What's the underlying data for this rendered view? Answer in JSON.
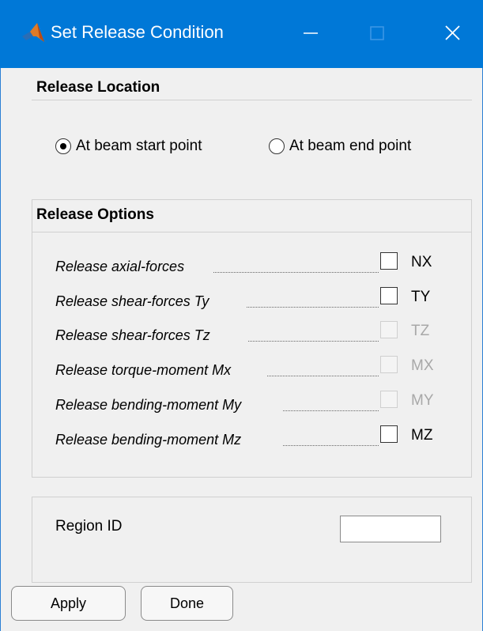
{
  "window": {
    "title": "Set Release Condition",
    "accent_color": "#0078d7",
    "icon": "matlab-logo-icon"
  },
  "release_location": {
    "heading": "Release Location",
    "options": [
      {
        "label": "At beam start point",
        "selected": true
      },
      {
        "label": "At beam end point",
        "selected": false
      }
    ]
  },
  "release_options": {
    "heading": "Release Options",
    "items": [
      {
        "label": "Release axial-forces",
        "code": "NX",
        "checked": false,
        "enabled": true
      },
      {
        "label": "Release shear-forces Ty",
        "code": "TY",
        "checked": false,
        "enabled": true
      },
      {
        "label": "Release shear-forces Tz",
        "code": "TZ",
        "checked": false,
        "enabled": false
      },
      {
        "label": "Release torque-moment Mx",
        "code": "MX",
        "checked": false,
        "enabled": false
      },
      {
        "label": "Release bending-moment My",
        "code": "MY",
        "checked": false,
        "enabled": false
      },
      {
        "label": "Release bending-moment Mz",
        "code": "MZ",
        "checked": false,
        "enabled": true
      }
    ]
  },
  "region": {
    "label": "Region ID",
    "value": ""
  },
  "buttons": {
    "apply": "Apply",
    "done": "Done"
  }
}
